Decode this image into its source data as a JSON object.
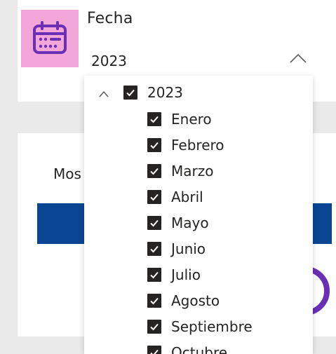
{
  "slicer": {
    "title": "Fecha",
    "icon": "calendar-icon",
    "selected_value": "2023",
    "accent_tile_color": "#f2a7d8",
    "icon_color": "#6b2fb5"
  },
  "background_card": {
    "label_fragment": "Mos"
  },
  "dropdown": {
    "year": {
      "label": "2023",
      "checked": true,
      "expanded": true
    },
    "months": [
      {
        "label": "Enero",
        "checked": true
      },
      {
        "label": "Febrero",
        "checked": true
      },
      {
        "label": "Marzo",
        "checked": true
      },
      {
        "label": "Abril",
        "checked": true
      },
      {
        "label": "Mayo",
        "checked": true
      },
      {
        "label": "Junio",
        "checked": true
      },
      {
        "label": "Julio",
        "checked": true
      },
      {
        "label": "Agosto",
        "checked": true
      },
      {
        "label": "Septiembre",
        "checked": true
      },
      {
        "label": "Octubre",
        "checked": true
      }
    ]
  },
  "colors": {
    "blue_bar": "#0a4593",
    "purple_circle": "#6b2fb5",
    "checkbox": "#252423"
  }
}
